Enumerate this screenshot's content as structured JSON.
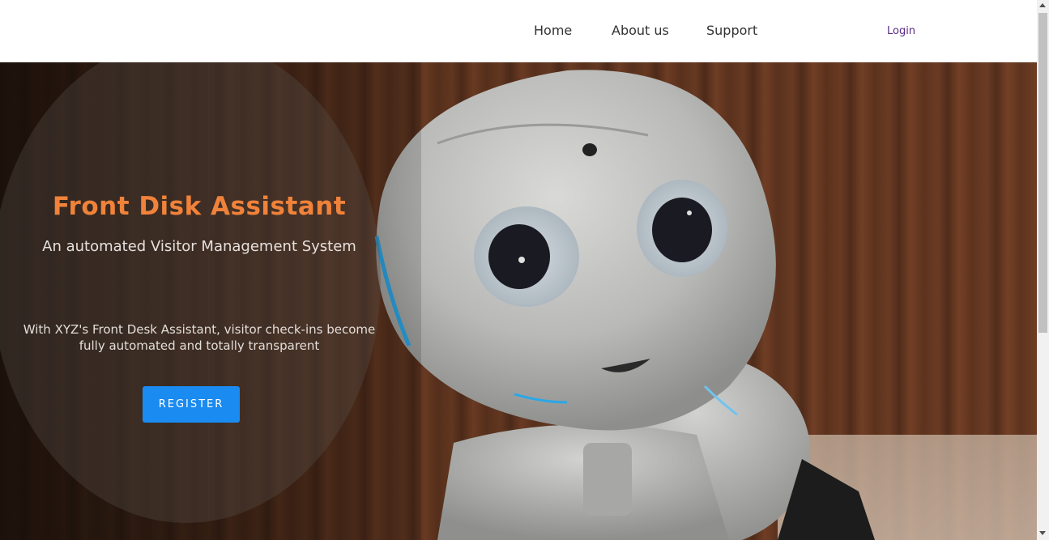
{
  "nav": {
    "home": "Home",
    "about": "About us",
    "support": "Support",
    "login": "Login"
  },
  "hero": {
    "title": "Front Disk Assistant",
    "subtitle": "An automated Visitor Management System",
    "description": "With XYZ's Front Desk Assistant, visitor check-ins become fully automated and totally transparent",
    "register_label": "REGISTER",
    "image_icon": "robot-photo"
  },
  "colors": {
    "accent": "#f0823a",
    "button": "#1a8bf0",
    "login": "#5b2a86"
  }
}
